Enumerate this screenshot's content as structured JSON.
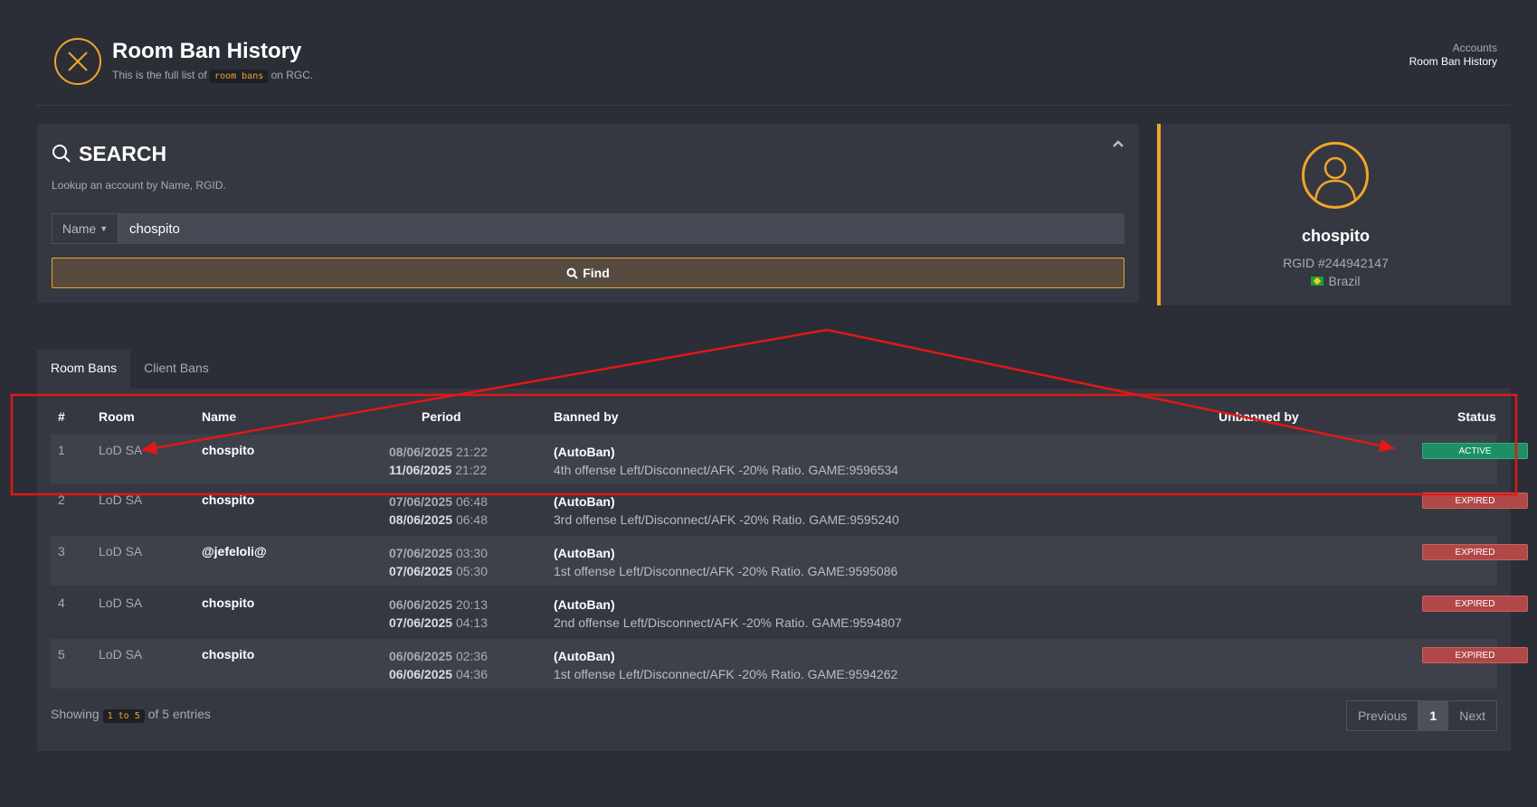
{
  "header": {
    "title": "Room Ban History",
    "subtitle_pre": "This is the full list of",
    "subtitle_code": "room bans",
    "subtitle_post": "on RGC.",
    "breadcrumb": [
      "Accounts",
      "Room Ban History"
    ],
    "logo_icon": "close-circle-icon"
  },
  "search": {
    "title": "SEARCH",
    "description": "Lookup an account by Name, RGID.",
    "selector_label": "Name",
    "input_value": "chospito",
    "find_label": "Find"
  },
  "profile": {
    "name": "chospito",
    "rgid": "RGID #244942147",
    "country": "Brazil"
  },
  "tabs": [
    {
      "label": "Room Bans",
      "active": true
    },
    {
      "label": "Client Bans",
      "active": false
    }
  ],
  "table": {
    "columns": [
      "#",
      "Room",
      "Name",
      "Period",
      "Banned by",
      "Unbanned by",
      "Status"
    ],
    "rows": [
      {
        "num": "1",
        "room": "LoD SA",
        "name": "chospito",
        "start_date": "08/06/2025",
        "start_time": "21:22",
        "end_date": "11/06/2025",
        "end_time": "21:22",
        "banned_by": "(AutoBan)",
        "reason": "4th offense Left/Disconnect/AFK -20% Ratio. GAME:9596534",
        "status": "ACTIVE"
      },
      {
        "num": "2",
        "room": "LoD SA",
        "name": "chospito",
        "start_date": "07/06/2025",
        "start_time": "06:48",
        "end_date": "08/06/2025",
        "end_time": "06:48",
        "banned_by": "(AutoBan)",
        "reason": "3rd offense Left/Disconnect/AFK -20% Ratio. GAME:9595240",
        "status": "EXPIRED"
      },
      {
        "num": "3",
        "room": "LoD SA",
        "name": "@jefeloli@",
        "start_date": "07/06/2025",
        "start_time": "03:30",
        "end_date": "07/06/2025",
        "end_time": "05:30",
        "banned_by": "(AutoBan)",
        "reason": "1st offense Left/Disconnect/AFK -20% Ratio. GAME:9595086",
        "status": "EXPIRED"
      },
      {
        "num": "4",
        "room": "LoD SA",
        "name": "chospito",
        "start_date": "06/06/2025",
        "start_time": "20:13",
        "end_date": "07/06/2025",
        "end_time": "04:13",
        "banned_by": "(AutoBan)",
        "reason": "2nd offense Left/Disconnect/AFK -20% Ratio. GAME:9594807",
        "status": "EXPIRED"
      },
      {
        "num": "5",
        "room": "LoD SA",
        "name": "chospito",
        "start_date": "06/06/2025",
        "start_time": "02:36",
        "end_date": "06/06/2025",
        "end_time": "04:36",
        "banned_by": "(AutoBan)",
        "reason": "1st offense Left/Disconnect/AFK -20% Ratio. GAME:9594262",
        "status": "EXPIRED"
      }
    ]
  },
  "footer": {
    "showing_pre": "Showing",
    "showing_code": "1 to 5",
    "showing_post": "of 5 entries",
    "pagination": [
      "Previous",
      "1",
      "Next"
    ]
  },
  "colors": {
    "accent": "#f0a52b",
    "active": "#1e8e64",
    "expired": "#b04848",
    "annotation": "#e01818"
  }
}
